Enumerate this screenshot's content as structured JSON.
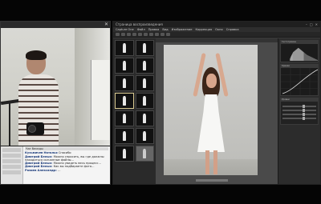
{
  "left_pane": {
    "close_glyph": "✕",
    "chat": {
      "header": "Чат беседы",
      "messages": [
        {
          "author": "Кузьмичев Наталья",
          "text": "Спасибо"
        },
        {
          "author": "Дмитрий Белых:",
          "text": "Можно спросить, вы где должны находиться скачанные файлы..."
        },
        {
          "author": "Дмитрий Белых:",
          "text": "Можно увидеть весь процесс..."
        },
        {
          "author": "Дмитрий Белых:",
          "text": "Как вы подбираете фото..."
        },
        {
          "author": "Разиев Александр:",
          "text": "..."
        }
      ]
    }
  },
  "editor": {
    "window_title": "Страница воспроизведения",
    "window_controls": [
      "–",
      "□",
      "✕"
    ],
    "menu": [
      "Capture One",
      "Файл",
      "Правка",
      "Вид",
      "Изображение",
      "Коррекция",
      "Окно",
      "Справка"
    ],
    "tools": {
      "histogram_label": "Гистограмма",
      "curve_label": "Кривая",
      "levels_label": "Уровни"
    }
  }
}
